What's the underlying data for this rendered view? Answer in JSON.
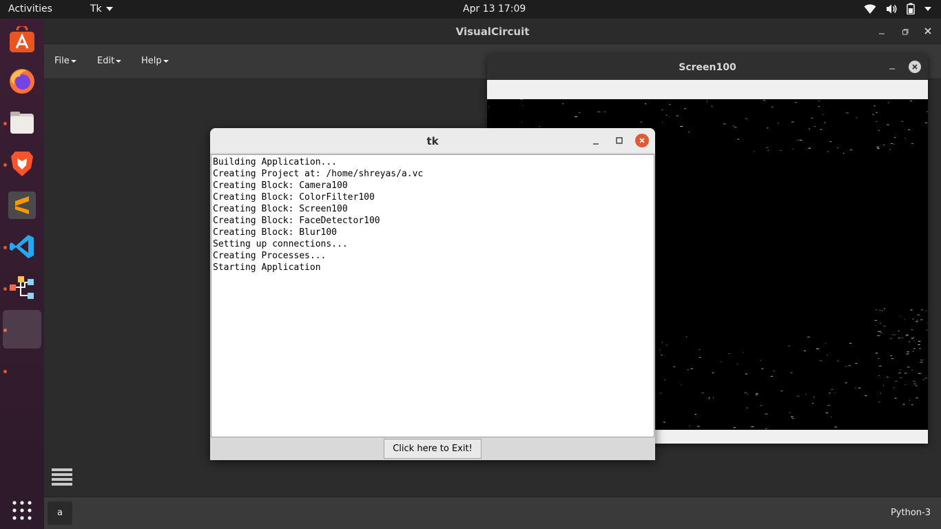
{
  "topbar": {
    "activities": "Activities",
    "app_menu": "Tk",
    "clock": "Apr 13  17:09",
    "tray_icons": [
      "wifi-icon",
      "volume-icon",
      "battery-icon",
      "system-menu-caret"
    ]
  },
  "dock": {
    "items": [
      {
        "name": "software-center",
        "active": false,
        "running": false
      },
      {
        "name": "firefox",
        "active": false,
        "running": false
      },
      {
        "name": "files",
        "active": false,
        "running": true
      },
      {
        "name": "brave",
        "active": false,
        "running": true
      },
      {
        "name": "sublime-text",
        "active": false,
        "running": false
      },
      {
        "name": "vscode",
        "active": false,
        "running": true
      },
      {
        "name": "visualcircuit",
        "active": false,
        "running": true
      },
      {
        "name": "python-tk",
        "active": true,
        "running": true
      },
      {
        "name": "unknown-app",
        "active": false,
        "running": true
      }
    ],
    "show_apps": "show-applications-icon"
  },
  "main_window": {
    "title": "VisualCircuit",
    "menus": [
      "File",
      "Edit",
      "Help"
    ],
    "status_box": "a",
    "status_right": "Python-3"
  },
  "screen_window": {
    "title": "Screen100"
  },
  "tk_window": {
    "title": "tk",
    "log_lines": [
      "Building Application...",
      "Creating Project at: /home/shreyas/a.vc",
      "Creating Block: Camera100",
      "Creating Block: ColorFilter100",
      "Creating Block: Screen100",
      "Creating Block: FaceDetector100",
      "Creating Block: Blur100",
      "Setting up connections...",
      "Creating Processes...",
      "Starting Application"
    ],
    "exit_button": "Click here to Exit!"
  },
  "colors": {
    "ubuntu_orange": "#e95420",
    "close_red": "#e05b35"
  }
}
